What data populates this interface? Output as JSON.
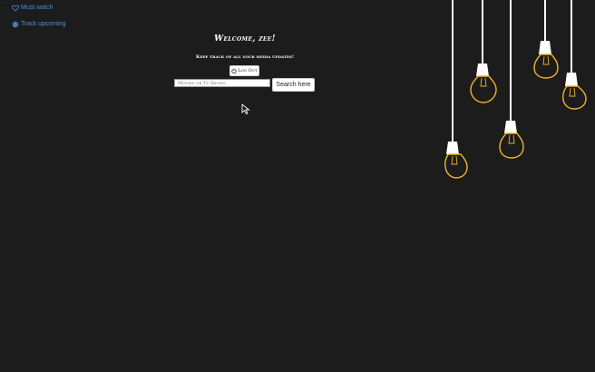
{
  "nav": {
    "items": [
      {
        "label": "Must watch",
        "icon": "heart-icon"
      },
      {
        "label": "Track upcoming",
        "icon": "globe-icon"
      }
    ]
  },
  "main": {
    "welcome": "Welcome, zee!",
    "tagline": "Keep track of all your media updates!",
    "logout_label": "Log Out",
    "logout_icon": "power-icon",
    "search_placeholder": "Movies or Tv Shows",
    "search_value": "",
    "search_button": "Search here"
  },
  "decor": {
    "items": [
      "light-bulb-icon",
      "light-bulb-icon",
      "light-bulb-icon",
      "light-bulb-icon",
      "light-bulb-icon"
    ]
  },
  "colors": {
    "background": "#1c1c1c",
    "link": "#4a90d9",
    "bulb_glow": "#f0b429",
    "text": "#ffffff"
  }
}
